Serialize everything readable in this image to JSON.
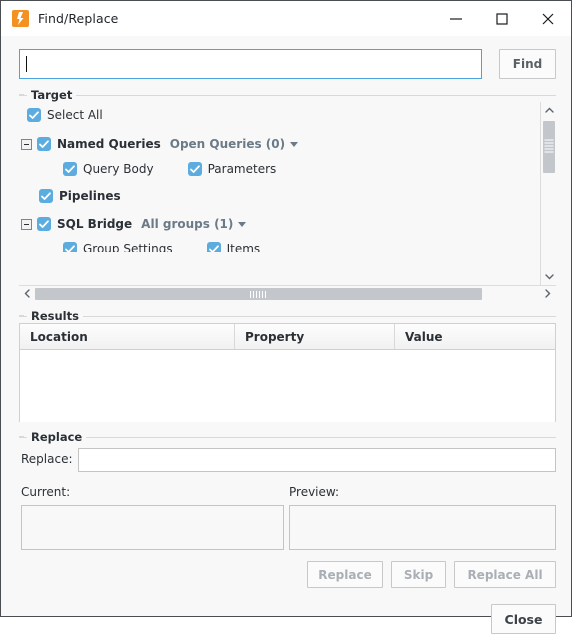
{
  "window": {
    "title": "Find/Replace",
    "icon": "ignition-logo-icon",
    "controls": {
      "minimize": "minimize-icon",
      "maximize": "maximize-icon",
      "close": "close-icon"
    }
  },
  "search": {
    "value": "",
    "placeholder": "",
    "find_label": "Find"
  },
  "target": {
    "title": "Target",
    "select_all": {
      "label": "Select All",
      "checked": true
    },
    "nodes": [
      {
        "label": "Named Queries",
        "checked": true,
        "expanded": true,
        "dropdown": "Open Queries (0)",
        "children": [
          {
            "label": "Query Body",
            "checked": true
          },
          {
            "label": "Parameters",
            "checked": true
          }
        ]
      },
      {
        "label": "Pipelines",
        "checked": true,
        "expanded": false,
        "dropdown": "",
        "children": []
      },
      {
        "label": "SQL Bridge",
        "checked": true,
        "expanded": true,
        "dropdown": "All groups (1)",
        "children": [
          {
            "label": "Group Settings",
            "checked": true
          },
          {
            "label": "Items",
            "checked": true
          }
        ]
      }
    ]
  },
  "results": {
    "title": "Results",
    "columns": [
      "Location",
      "Property",
      "Value"
    ],
    "rows": []
  },
  "replace": {
    "title": "Replace",
    "field_label": "Replace:",
    "field_value": "",
    "current_label": "Current:",
    "current_value": "",
    "preview_label": "Preview:",
    "preview_value": "",
    "buttons": {
      "replace": "Replace",
      "skip": "Skip",
      "replace_all": "Replace All"
    }
  },
  "footer": {
    "close_label": "Close"
  },
  "colors": {
    "accent": "#5cacdf",
    "focus_border": "#4aa3df",
    "brand_orange": "#f49123",
    "dropdown_link": "#6b7a88",
    "background": "#f8f8f8"
  }
}
